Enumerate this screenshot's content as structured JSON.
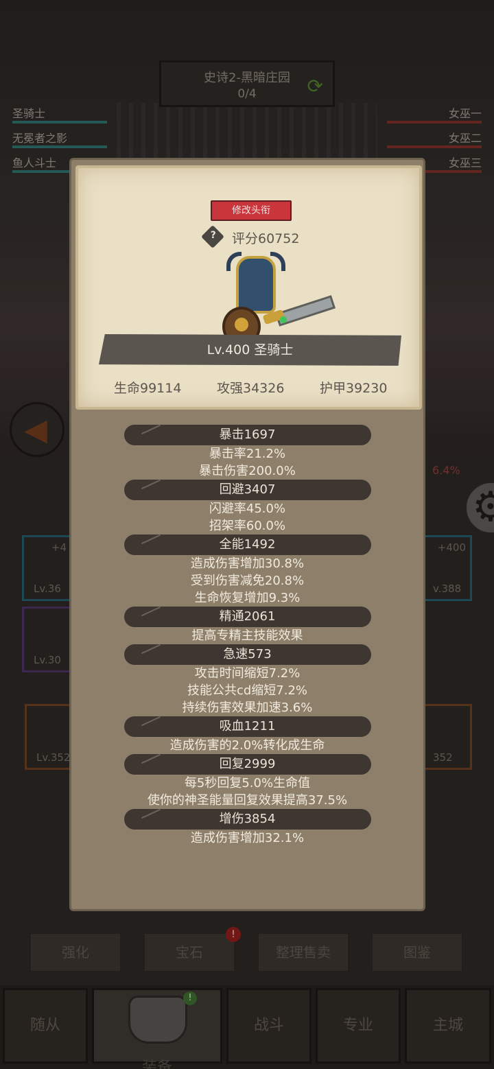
{
  "stage": {
    "name": "史诗2-黑暗庄园",
    "progress": "0/4"
  },
  "party_left": [
    "圣骑士",
    "无冕者之影",
    "鱼人斗士"
  ],
  "party_right": [
    "女巫一",
    "女巫二",
    "女巫三"
  ],
  "background": {
    "percent_text": "6.4%",
    "slots": [
      {
        "lv": "Lv.36",
        "plus": "+4"
      },
      {
        "lv": "Lv.30",
        "plus": ""
      },
      {
        "lv": "Lv.352",
        "plus": ""
      },
      {
        "lv": "v.388",
        "plus": "+400"
      },
      {
        "lv": "352",
        "plus": ""
      }
    ]
  },
  "toolbar": {
    "enhance": "强化",
    "gem": "宝石",
    "organize_sell": "整理售卖",
    "codex": "图鉴",
    "gem_badge": "!"
  },
  "nav": {
    "followers": "随从",
    "equipment": "装备",
    "battle": "战斗",
    "profession": "专业",
    "main_city": "主城",
    "equip_badge": "!"
  },
  "modal": {
    "rename_button": "修改头衔",
    "score": "评分60752",
    "hero_name": "Lv.400 圣骑士",
    "hp": "生命99114",
    "attack": "攻强34326",
    "armor": "护甲39230",
    "attributes": [
      {
        "header": "暴击1697",
        "lines": [
          "暴击率21.2%",
          "暴击伤害200.0%"
        ]
      },
      {
        "header": "回避3407",
        "lines": [
          "闪避率45.0%",
          "招架率60.0%"
        ]
      },
      {
        "header": "全能1492",
        "lines": [
          "造成伤害增加30.8%",
          "受到伤害减免20.8%",
          "生命恢复增加9.3%"
        ]
      },
      {
        "header": "精通2061",
        "lines": [
          "提高专精主技能效果"
        ]
      },
      {
        "header": "急速573",
        "lines": [
          "攻击时间缩短7.2%",
          "技能公共cd缩短7.2%",
          "持续伤害效果加速3.6%"
        ]
      },
      {
        "header": "吸血1211",
        "lines": [
          "造成伤害的2.0%转化成生命"
        ]
      },
      {
        "header": "回复2999",
        "lines": [
          "每5秒回复5.0%生命值",
          "使你的神圣能量回复效果提高37.5%"
        ]
      },
      {
        "header": "增伤3854",
        "lines": [
          "造成伤害增加32.1%"
        ]
      }
    ]
  }
}
